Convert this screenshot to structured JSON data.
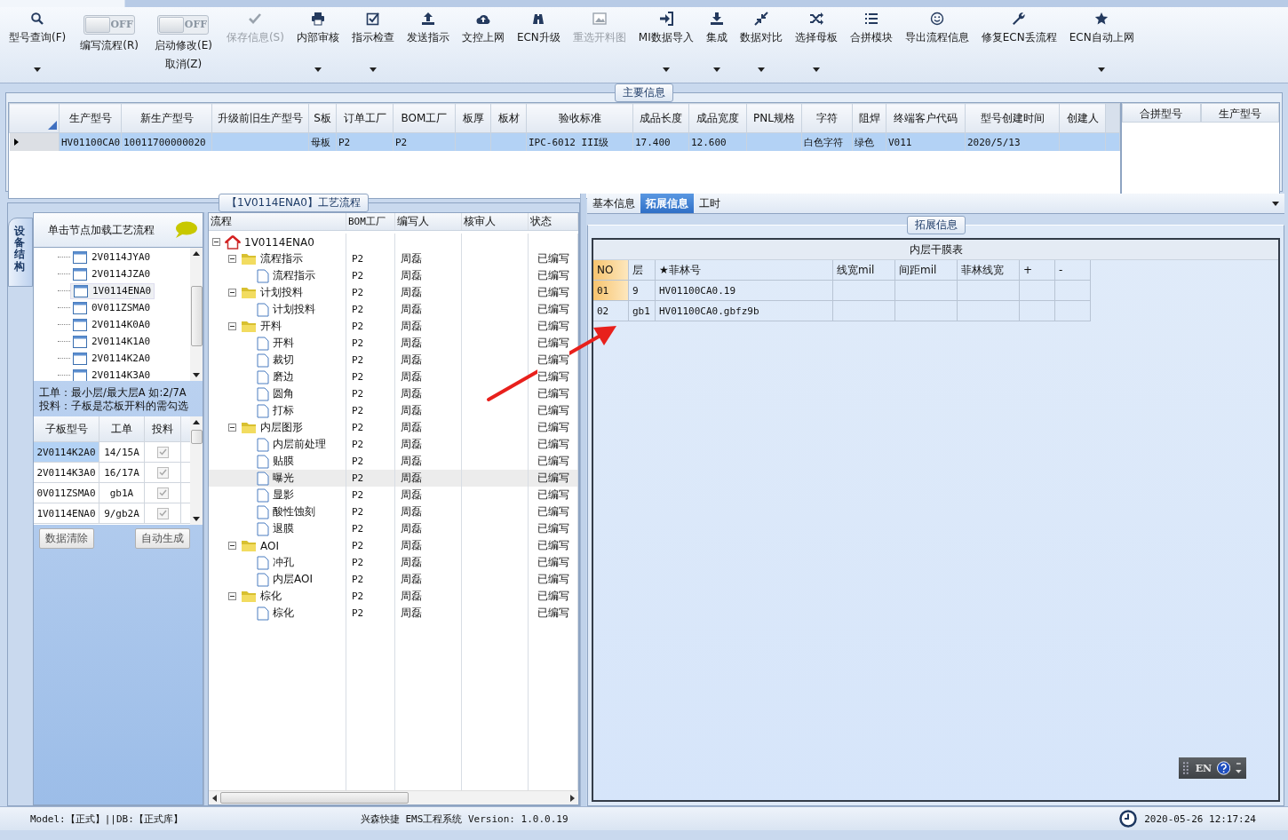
{
  "toolbar": [
    {
      "kind": "button",
      "label": "型号查询(F)",
      "dropdown": true,
      "disabled": false
    },
    {
      "kind": "toggle",
      "label": "编写流程(R)",
      "toggle_text": "OFF",
      "on": false
    },
    {
      "kind": "toggle",
      "label": "启动修改(E)",
      "sublabel": "取消(Z)",
      "toggle_text": "OFF",
      "on": false
    },
    {
      "kind": "button",
      "label": "保存信息(S)",
      "dropdown": false,
      "disabled": true
    },
    {
      "kind": "button",
      "label": "内部审核",
      "dropdown": true,
      "disabled": false
    },
    {
      "kind": "button",
      "label": "指示检查",
      "dropdown": true,
      "disabled": false
    },
    {
      "kind": "button",
      "label": "发送指示",
      "dropdown": false,
      "disabled": false
    },
    {
      "kind": "button",
      "label": "文控上网",
      "dropdown": false,
      "disabled": false
    },
    {
      "kind": "button",
      "label": "ECN升级",
      "dropdown": false,
      "disabled": false
    },
    {
      "kind": "button",
      "label": "重选开料图",
      "dropdown": false,
      "disabled": true
    },
    {
      "kind": "button",
      "label": "MI数据导入",
      "dropdown": true,
      "disabled": false
    },
    {
      "kind": "button",
      "label": "集成",
      "dropdown": true,
      "disabled": false
    },
    {
      "kind": "button",
      "label": "数据对比",
      "dropdown": true,
      "disabled": false
    },
    {
      "kind": "button",
      "label": "选择母板",
      "dropdown": true,
      "disabled": false
    },
    {
      "kind": "button",
      "label": "合拼模块",
      "dropdown": false,
      "disabled": false
    },
    {
      "kind": "button",
      "label": "导出流程信息",
      "dropdown": false,
      "disabled": false
    },
    {
      "kind": "button",
      "label": "修复ECN丢流程",
      "dropdown": false,
      "disabled": false
    },
    {
      "kind": "button",
      "label": "ECN自动上网",
      "dropdown": true,
      "disabled": false
    }
  ],
  "main_info": {
    "title": "主要信息",
    "columns": [
      "生产型号",
      "新生产型号",
      "升级前旧生产型号",
      "S板",
      "订单工厂",
      "BOM工厂",
      "板厚",
      "板材",
      "验收标准",
      "成品长度",
      "成品宽度",
      "PNL规格",
      "字符",
      "阻焊",
      "终端客户代码",
      "型号创建时间",
      "创建人"
    ],
    "rows": [
      {
        "selected": true,
        "cells": [
          "HV01100CA0",
          "10011700000020",
          null,
          "母板",
          "P2",
          "P2",
          null,
          null,
          "IPC-6012 III级",
          "17.400",
          "12.600",
          null,
          "白色字符",
          "绿色",
          "V011",
          "2020/5/13",
          null
        ]
      }
    ],
    "side_columns": [
      "合拼型号",
      "生产型号"
    ]
  },
  "process_panel": {
    "title": "【1V0114ENA0】工艺流程"
  },
  "structure_panel": {
    "tab": "设备结构",
    "hint": "单击节点加载工艺流程",
    "items": [
      {
        "label": "2V0114JYA0",
        "selected": false
      },
      {
        "label": "2V0114JZA0",
        "selected": false
      },
      {
        "label": "1V0114ENA0",
        "selected": true
      },
      {
        "label": "0V011ZSMA0",
        "selected": false
      },
      {
        "label": "2V0114K0A0",
        "selected": false
      },
      {
        "label": "2V0114K1A0",
        "selected": false
      },
      {
        "label": "2V0114K2A0",
        "selected": false
      },
      {
        "label": "2V0114K3A0",
        "selected": false
      }
    ],
    "notes": [
      "工单：最小层/最大层A 如:2/7A",
      "投料：子板是芯板开料的需勾选"
    ],
    "columns": [
      "子板型号",
      "工单",
      "投料"
    ],
    "rows": [
      {
        "board": "2V0114K2A0",
        "order": "14/15A",
        "checked": true,
        "selected": true
      },
      {
        "board": "2V0114K3A0",
        "order": "16/17A",
        "checked": true,
        "selected": false
      },
      {
        "board": "0V011ZSMA0",
        "order": "gb1A",
        "checked": true,
        "selected": false
      },
      {
        "board": "1V0114ENA0",
        "order": "9/gb2A",
        "checked": true,
        "selected": false
      }
    ],
    "buttons": [
      "数据清除",
      "自动生成"
    ]
  },
  "flow": {
    "columns": [
      "流程",
      "BOM工厂",
      "编写人",
      "核审人",
      "状态"
    ],
    "root": {
      "label": "1V0114ENA0",
      "expanded": true,
      "selected": false,
      "children": [
        {
          "label": "流程指示",
          "bom": "P2",
          "writer": "周磊",
          "status": "已编写",
          "expanded": true,
          "selected": false,
          "children": [
            {
              "label": "流程指示",
              "bom": "P2",
              "writer": "周磊",
              "status": "已编写",
              "selected": false
            }
          ]
        },
        {
          "label": "计划投料",
          "bom": "P2",
          "writer": "周磊",
          "status": "已编写",
          "expanded": true,
          "selected": false,
          "children": [
            {
              "label": "计划投料",
              "bom": "P2",
              "writer": "周磊",
              "status": "已编写",
              "selected": false
            }
          ]
        },
        {
          "label": "开料",
          "bom": "P2",
          "writer": "周磊",
          "status": "已编写",
          "expanded": true,
          "selected": false,
          "children": [
            {
              "label": "开料",
              "bom": "P2",
              "writer": "周磊",
              "status": "已编写",
              "selected": false
            },
            {
              "label": "裁切",
              "bom": "P2",
              "writer": "周磊",
              "status": "已编写",
              "selected": false
            },
            {
              "label": "磨边",
              "bom": "P2",
              "writer": "周磊",
              "status": "已编写",
              "selected": false
            },
            {
              "label": "圆角",
              "bom": "P2",
              "writer": "周磊",
              "status": "已编写",
              "selected": false
            },
            {
              "label": "打标",
              "bom": "P2",
              "writer": "周磊",
              "status": "已编写",
              "selected": false
            }
          ]
        },
        {
          "label": "内层图形",
          "bom": "P2",
          "writer": "周磊",
          "status": "已编写",
          "expanded": true,
          "selected": false,
          "children": [
            {
              "label": "内层前处理",
              "bom": "P2",
              "writer": "周磊",
              "status": "已编写",
              "selected": false
            },
            {
              "label": "贴膜",
              "bom": "P2",
              "writer": "周磊",
              "status": "已编写",
              "selected": false
            },
            {
              "label": "曝光",
              "bom": "P2",
              "writer": "周磊",
              "status": "已编写",
              "selected": true
            },
            {
              "label": "显影",
              "bom": "P2",
              "writer": "周磊",
              "status": "已编写",
              "selected": false
            },
            {
              "label": "酸性蚀刻",
              "bom": "P2",
              "writer": "周磊",
              "status": "已编写",
              "selected": false
            },
            {
              "label": "退膜",
              "bom": "P2",
              "writer": "周磊",
              "status": "已编写",
              "selected": false
            }
          ]
        },
        {
          "label": "AOI",
          "bom": "P2",
          "writer": "周磊",
          "status": "已编写",
          "expanded": true,
          "selected": false,
          "children": [
            {
              "label": "冲孔",
              "bom": "P2",
              "writer": "周磊",
              "status": "已编写",
              "selected": false
            },
            {
              "label": "内层AOI",
              "bom": "P2",
              "writer": "周磊",
              "status": "已编写",
              "selected": false
            }
          ]
        },
        {
          "label": "棕化",
          "bom": "P2",
          "writer": "周磊",
          "status": "已编写",
          "expanded": true,
          "selected": false,
          "children": [
            {
              "label": "棕化",
              "bom": "P2",
              "writer": "周磊",
              "status": "已编写",
              "selected": false
            }
          ]
        }
      ]
    }
  },
  "detail_tabs": [
    {
      "label": "基本信息",
      "selected": false
    },
    {
      "label": "拓展信息",
      "selected": true
    },
    {
      "label": "工时",
      "selected": false
    }
  ],
  "extension": {
    "title": "拓展信息",
    "table_title": "内层干膜表",
    "columns": [
      "NO",
      "层",
      "★菲林号",
      "线宽mil",
      "间距mil",
      "菲林线宽",
      "+",
      "-"
    ],
    "rows": [
      {
        "no": "01",
        "layer": "9",
        "film": "HV01100CA0.19",
        "selected": true
      },
      {
        "no": "02",
        "layer": "gb1",
        "film": "HV01100CA0.gbfz9b",
        "selected": false
      }
    ]
  },
  "language_bar": {
    "label": "EN"
  },
  "annotation": {
    "kind": "arrow",
    "color": "#e8201c"
  },
  "status_bar": {
    "left": "Model:【正式】||DB:【正式库】",
    "center": "兴森快捷 EMS工程系统 Version: 1.0.0.19",
    "time": "2020-05-26 12:17:24"
  }
}
